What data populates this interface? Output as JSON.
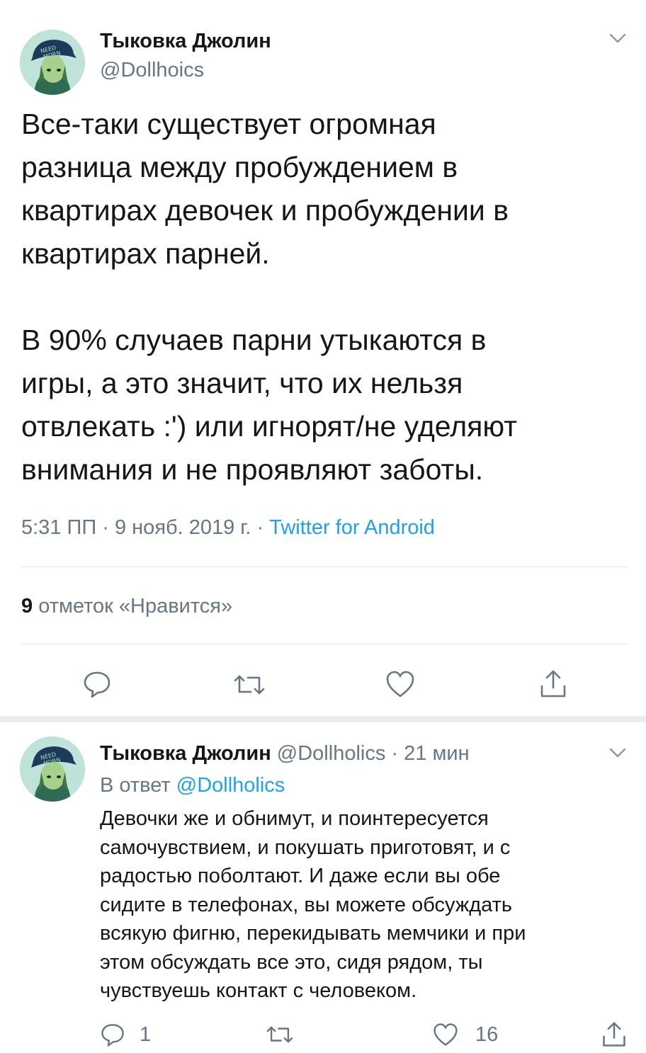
{
  "main_tweet": {
    "author_name": "Тыковка Джолин",
    "author_handle": "@Dollhoics",
    "text": "Все-таки существует огромная\nразница между пробуждением в\nквартирах девочек и пробуждении в\nквартирах парней.\n\nВ 90% случаев парни утыкаются в\nигры, а это значит, что их нельзя\nотвлекать :') или игнорят/не уделяют\nвнимания и не проявляют заботы.",
    "time": "5:31 ПП",
    "date": "9 нояб. 2019 г.",
    "dot": "·",
    "source": "Twitter for Android",
    "likes_count": "9",
    "likes_label": "отметок «Нравится»"
  },
  "reply_tweet": {
    "author_name": "Тыковка Джолин",
    "author_handle": "@Dollholics",
    "dot": "·",
    "time_ago": "21 мин",
    "reply_prefix": "В ответ",
    "reply_to": "@Dollholics",
    "text": "Девочки же и обнимут, и поинтересуется\nсамочувствием, и покушать приготовят, и с\nрадостью поболтают. И даже если вы обе\nсидите в телефонах, вы можете обсуждать\nвсякую фигню, перекидывать мемчики и при\nэтом обсуждать все это, сидя рядом, ты\nчувствуешь контакт с человеком.",
    "reply_count": "1",
    "like_count": "16"
  },
  "avatar_cap_text": "NEED MORN",
  "colors": {
    "accent": "#1da1f2",
    "secondary_text": "#657786",
    "divider": "#e1e8ed"
  },
  "icons": [
    "chevron-down-icon",
    "reply-icon",
    "retweet-icon",
    "like-icon",
    "share-icon"
  ]
}
